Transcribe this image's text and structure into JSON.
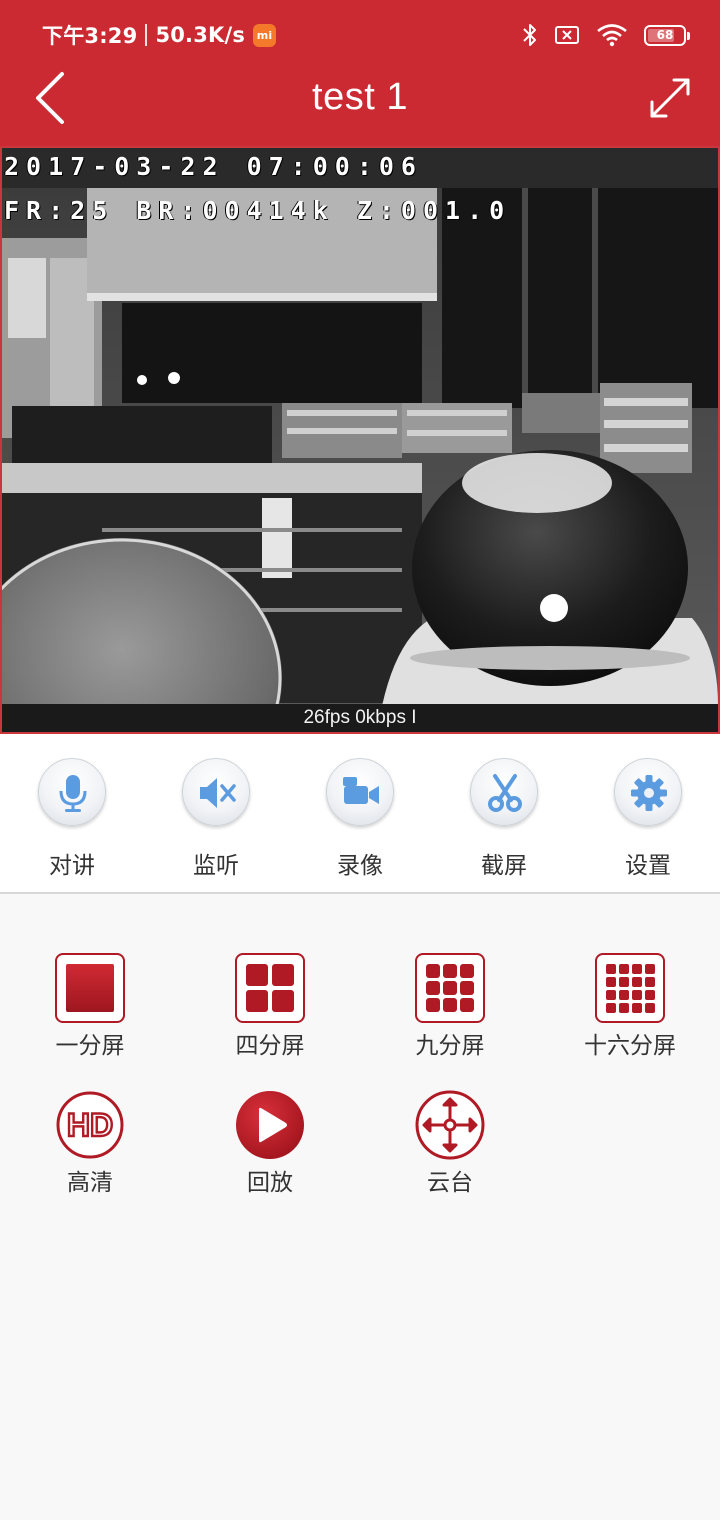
{
  "status_bar": {
    "time": "下午3:29",
    "speed": "50.3K/s",
    "mi_badge": "mi",
    "battery": "68"
  },
  "header": {
    "title": "test 1"
  },
  "video": {
    "osd_line1": "2017-03-22 07:00:06",
    "osd_line2": "FR:25 BR:00414k Z:001.0",
    "info": "26fps 0kbps I"
  },
  "toolbar": {
    "items": [
      {
        "label": "对讲",
        "icon": "microphone-icon"
      },
      {
        "label": "监听",
        "icon": "speaker-mute-icon"
      },
      {
        "label": "录像",
        "icon": "video-record-icon"
      },
      {
        "label": "截屏",
        "icon": "scissors-icon"
      },
      {
        "label": "设置",
        "icon": "gear-icon"
      }
    ]
  },
  "options": {
    "split": [
      {
        "label": "一分屏",
        "icon": "one-split-icon"
      },
      {
        "label": "四分屏",
        "icon": "four-split-icon"
      },
      {
        "label": "九分屏",
        "icon": "nine-split-icon"
      },
      {
        "label": "十六分屏",
        "icon": "sixteen-split-icon"
      }
    ],
    "extra": [
      {
        "label": "高清",
        "icon": "hd-icon"
      },
      {
        "label": "回放",
        "icon": "playback-icon"
      },
      {
        "label": "云台",
        "icon": "ptz-icon"
      }
    ]
  },
  "colors": {
    "header_red": "#cc2a32",
    "accent_red": "#b01a24",
    "tool_icon_blue": "#5b9be0"
  }
}
